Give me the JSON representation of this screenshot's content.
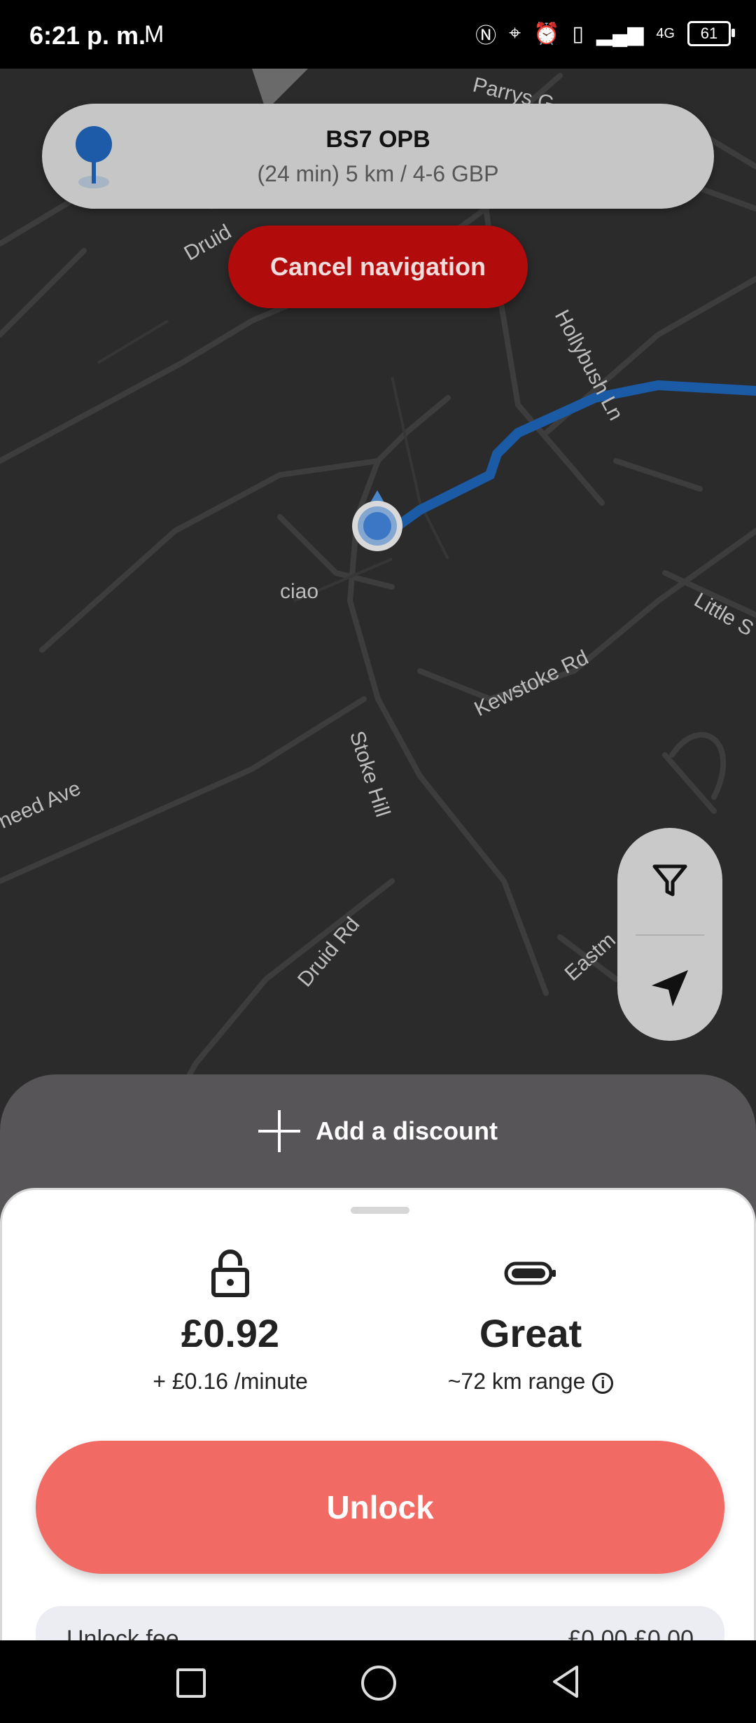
{
  "status_bar": {
    "time": "6:21 p. m.",
    "mail_icon": "M",
    "battery": "61",
    "network": "4G"
  },
  "map": {
    "streets": [
      "Parrys G",
      "Druid",
      "Hollybush Ln",
      "ciao",
      "Little S",
      "Kewstoke Rd",
      "Stoke Hill",
      "need Ave",
      "Druid Rd",
      "Eastm"
    ]
  },
  "destination": {
    "title": "BS7 OPB",
    "subtitle": "(24 min) 5 km / 4-6 GBP"
  },
  "cancel_navigation": "Cancel navigation",
  "discount": {
    "label": "Add a discount"
  },
  "pricing": {
    "price": "£0.92",
    "rate": "+ £0.16 /minute"
  },
  "battery_status": {
    "level": "Great",
    "range": "~72 km range"
  },
  "unlock": "Unlock",
  "peek": {
    "left": "Unlock fee",
    "right": "£0.00 £0.00"
  },
  "colors": {
    "accent": "#f16b64",
    "cancel": "#b10b0b",
    "route": "#1b5ba6"
  }
}
